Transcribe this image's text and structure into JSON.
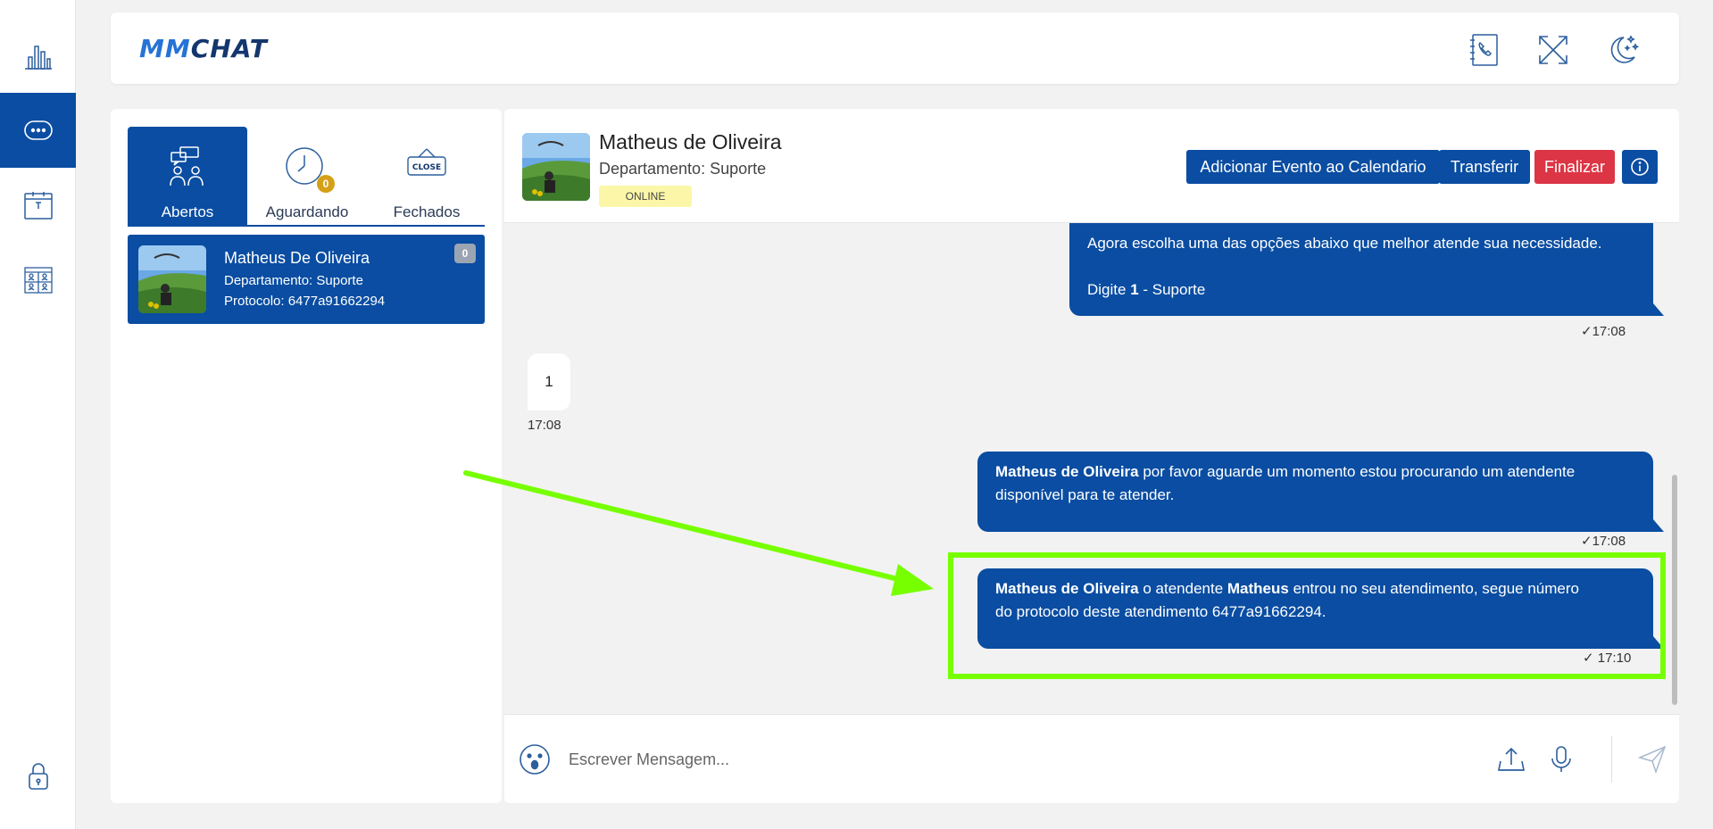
{
  "brand": {
    "logo_mm": "MM",
    "logo_chat": "CHAT"
  },
  "nav": [
    {
      "icon": "bar-chart-icon"
    },
    {
      "icon": "chat-bubble-icon",
      "active": true
    },
    {
      "icon": "calendar-icon"
    },
    {
      "icon": "team-grid-icon"
    },
    {
      "icon": "lock-icon"
    }
  ],
  "topbar": {
    "icons": [
      "phone-book-icon",
      "fullscreen-icon",
      "dark-mode-icon"
    ]
  },
  "tabs": [
    {
      "label": "Abertos",
      "icon": "team-chat-icon",
      "active": true
    },
    {
      "label": "Aguardando",
      "icon": "clock-icon",
      "badge": "0"
    },
    {
      "label": "Fechados",
      "icon": "close-sign-icon",
      "icon_text": "CLOSE"
    }
  ],
  "conversation_list": [
    {
      "name": "Matheus De Oliveira",
      "department": "Departamento: Suporte",
      "protocol": "Protocolo: 6477a91662294",
      "unread": "0"
    }
  ],
  "chat_header": {
    "name": "Matheus de Oliveira",
    "department": "Departamento: Suporte",
    "status": "ONLINE",
    "buttons": {
      "calendar": "Adicionar Evento ao Calendario",
      "transfer": "Transferir",
      "finish": "Finalizar"
    }
  },
  "messages": [
    {
      "direction": "out",
      "line1": "Agora escolha uma das opções abaixo que melhor atende sua necessidade.",
      "line2_prefix": "Digite ",
      "line2_bold": "1",
      "line2_suffix": " - Suporte",
      "time": "17:08"
    },
    {
      "direction": "in",
      "text": "1",
      "time": "17:08"
    },
    {
      "direction": "out",
      "bold_name": "Matheus de Oliveira",
      "text1": " por favor aguarde um momento estou procurando um atendente",
      "text2": "disponível para te atender.",
      "time": "17:08"
    },
    {
      "direction": "out",
      "bold_name": "Matheus de Oliveira",
      "text_mid": " o atendente ",
      "bold_agent": "Matheus",
      "text1_end": " entrou no seu atendimento, segue número",
      "text2": "do protocolo deste atendimento 6477a91662294.",
      "time": "17:10"
    }
  ],
  "composer": {
    "placeholder": "Escrever Mensagem..."
  },
  "colors": {
    "primary": "#0a4da2",
    "danger": "#dc3545",
    "highlight": "#77ff00",
    "status_bg": "#fcf7a8"
  }
}
